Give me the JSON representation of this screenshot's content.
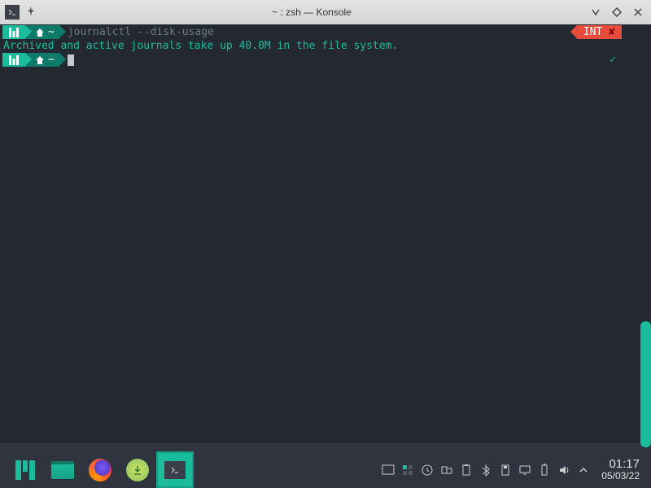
{
  "window": {
    "title": "~ : zsh — Konsole"
  },
  "terminal": {
    "prompt_dir": "~",
    "command": "journalctl --disk-usage",
    "int_label": "INT",
    "int_x": "✘",
    "output": "Archived and active journals take up 40.0M in the file system.",
    "checkmark": "✓"
  },
  "taskbar": {
    "time": "01:17",
    "date": "05/03/22"
  }
}
